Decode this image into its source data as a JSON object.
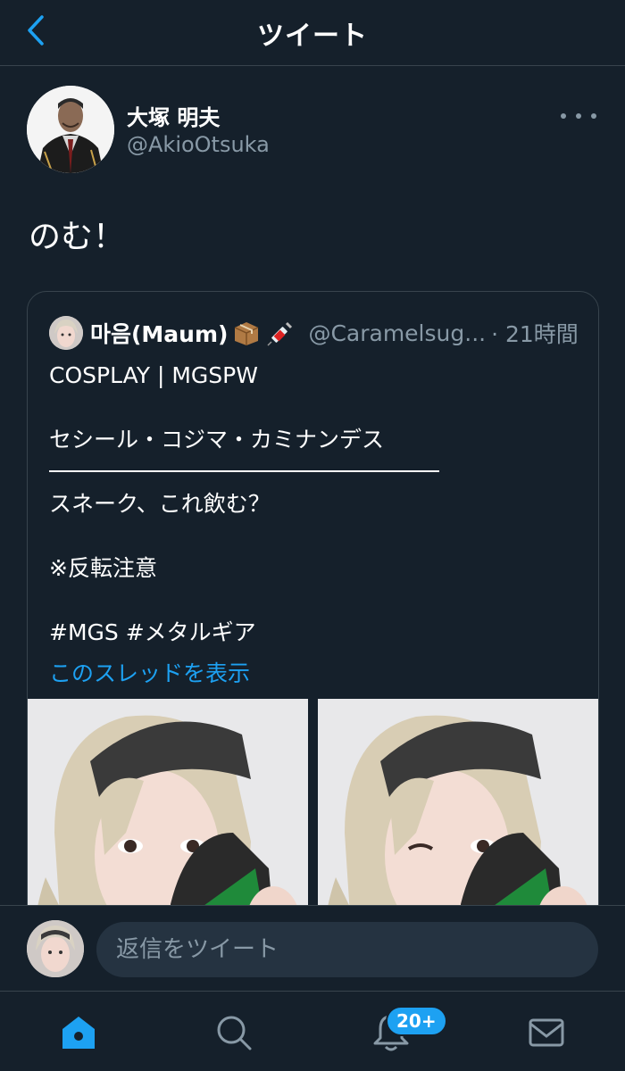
{
  "header": {
    "title": "ツイート",
    "back_icon": "chevron-left-icon"
  },
  "tweet": {
    "author_name": "大塚 明夫",
    "author_handle": "@AkioOtsuka",
    "text": "のむ！"
  },
  "quoted": {
    "name": "마음(Maum)",
    "emojis": [
      "package-emoji",
      "syringe-emoji"
    ],
    "handle": "@Caramelsug...",
    "time": "· 21時間",
    "lines": {
      "l1": "COSPLAY | MGSPW",
      "l2": "セシール・コジマ・カミナンデス",
      "l3": "スネーク、これ飲む？",
      "l4": "※反転注意",
      "l5": "#MGS  #メタルギア"
    },
    "thread_link": "このスレッドを表示"
  },
  "reply": {
    "placeholder": "返信をツイート"
  },
  "tabbar": {
    "items": [
      "home-icon",
      "search-icon",
      "notifications-icon",
      "messages-icon"
    ],
    "badge": "20+"
  },
  "colors": {
    "accent": "#1da1f2",
    "background": "#15202b",
    "muted": "#8899a6"
  }
}
